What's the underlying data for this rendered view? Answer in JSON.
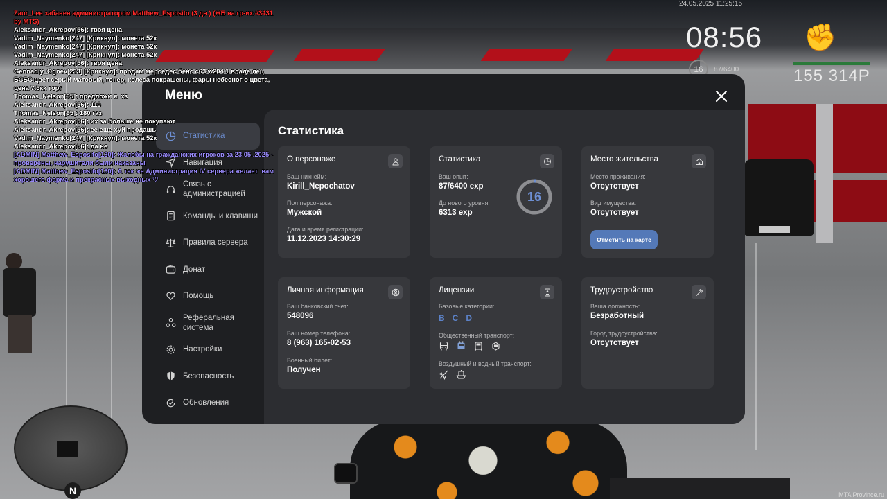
{
  "hud": {
    "date": "24.05.2025 11:25:15",
    "time": "08:56",
    "level": "16",
    "exp": "87/6400",
    "money": "155 314Р",
    "watermark": "MTA Province.ru"
  },
  "minimap": {
    "north": "N"
  },
  "chat": [
    {
      "text": "Zaur_Lee забанен администратором Matthew_Esposito (3 дн.) (ЖБ на гр-их #3431 by MTS)",
      "color": "#ff2a2a"
    },
    {
      "text": "Aleksandr_Akrepov[56]: твоя цена",
      "color": "#ffffff"
    },
    {
      "text": "Vadim_Naymenko[247] [Крикнул]: монета 52к",
      "color": "#ffffff"
    },
    {
      "text": "Vadim_Naymenko[247] [Крикнул]: монета 52к",
      "color": "#ffffff"
    },
    {
      "text": "Vadim_Naymenko[247] [Крикнул]: монета 52к",
      "color": "#ffffff"
    },
    {
      "text": "Aleksandr_Akrepov[56]: твоя цена",
      "color": "#ffffff"
    },
    {
      "text": "Gennadiy_Ognev[233] [Крикнул]: продам мерседес бенс с63 w204 1 владе лец БСБС цвет серый матовый, тонер, колеса покрашены, фары небесног о цвета, цена 7.5кк торг",
      "color": "#ffffff"
    },
    {
      "text": "Thomas_Nelson[95]: предложи я  хз",
      "color": "#ffffff"
    },
    {
      "text": "Aleksandr_Akrepov[56]: 110",
      "color": "#ffffff"
    },
    {
      "text": "Thomas_Nelson[95]: 180 газ",
      "color": "#ffffff"
    },
    {
      "text": "Aleksandr_Akrepov[56]: их за больше не покупают",
      "color": "#ffffff"
    },
    {
      "text": "Aleksandr_Akrepov[56]: ее еще хуй продашь",
      "color": "#ffffff"
    },
    {
      "text": "Vadim_Naymenko[247] [Крикнул]: монета 52к",
      "color": "#ffffff"
    },
    {
      "text": "Aleksandr_Akrepov[56]: да не",
      "color": "#ffffff"
    },
    {
      "text": "[ADMIN] Matthew_Esposito[130]: Жалобы на гражданских игроков за 23.05 .2025 - проверены, нарушители были наказаны",
      "color": "#9b8cff"
    },
    {
      "text": "[ADMIN] Matthew_Esposito[130]: А так же Администрация IV сервера желает  вам хорошего фарма и прекрасных выходных ♡",
      "color": "#9b8cff"
    }
  ],
  "menu": {
    "title": "Меню",
    "close_icon": "close-icon",
    "nav": [
      {
        "label": "Статистика",
        "icon": "chart-pie-icon",
        "active": true
      },
      {
        "label": "Навигация",
        "icon": "navigation-icon",
        "active": false
      },
      {
        "label": "Связь с администрацией",
        "icon": "headset-icon",
        "active": false
      },
      {
        "label": "Команды и клавиши",
        "icon": "document-icon",
        "active": false
      },
      {
        "label": "Правила сервера",
        "icon": "scales-icon",
        "active": false
      },
      {
        "label": "Донат",
        "icon": "wallet-icon",
        "active": false
      },
      {
        "label": "Помощь",
        "icon": "heart-hand-icon",
        "active": false
      },
      {
        "label": "Реферальная система",
        "icon": "referral-icon",
        "active": false
      },
      {
        "label": "Настройки",
        "icon": "gear-icon",
        "active": false
      },
      {
        "label": "Безопасность",
        "icon": "shield-icon",
        "active": false
      },
      {
        "label": "Обновления",
        "icon": "update-icon",
        "active": false
      }
    ]
  },
  "content": {
    "title": "Статистика",
    "character": {
      "title": "О персонаже",
      "nickname_label": "Ваш никнейм:",
      "nickname": "Kirill_Nepochatov",
      "gender_label": "Пол персонажа:",
      "gender": "Мужской",
      "reg_label": "Дата и время регистрации:",
      "reg": "11.12.2023 14:30:29"
    },
    "stats": {
      "title": "Статистика",
      "exp_label": "Ваш опыт:",
      "exp": "87/6400 exp",
      "next_label": "До нового уровня:",
      "next": "6313 exp",
      "level": "16",
      "progress": 0.0136,
      "accent": "#6d8fd3"
    },
    "residence": {
      "title": "Место жительства",
      "place_label": "Место проживания:",
      "place": "Отсутствует",
      "property_label": "Вид имущества:",
      "property": "Отсутствует",
      "map_button": "Отметить на карте",
      "button_color": "#5479b8"
    },
    "personal": {
      "title": "Личная информация",
      "bank_label": "Ваш банковский счет:",
      "bank": "548096",
      "phone_label": "Ваш номер телефона:",
      "phone": "8 (963) 165-02-53",
      "military_label": "Военный билет:",
      "military": "Получен"
    },
    "licenses": {
      "title": "Лицензии",
      "basic_label": "Базовые категории:",
      "categories": [
        "B",
        "C",
        "D"
      ],
      "public_label": "Общественный транспорт:",
      "public_icons": [
        "bus-icon",
        "trolleybus-icon",
        "tram-icon",
        "train-icon"
      ],
      "air_label": "Воздушный и водный транспорт:",
      "air_icons": [
        "plane-icon",
        "boat-icon"
      ]
    },
    "employment": {
      "title": "Трудоустройство",
      "position_label": "Ваша должность:",
      "position": "Безработный",
      "city_label": "Город трудоустройства:",
      "city": "Отсутствует"
    }
  }
}
